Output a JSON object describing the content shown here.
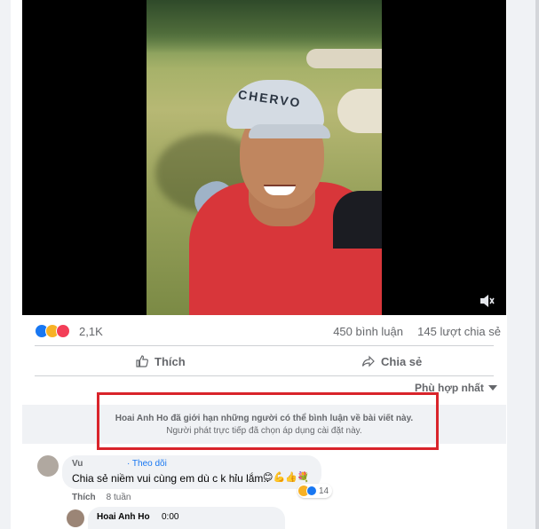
{
  "video": {
    "cap_brand": "CHERVO",
    "mute_icon": "speaker-muted-icon"
  },
  "stats": {
    "reaction_count": "2,1K",
    "comment_count": "450 bình luận",
    "share_count": "145 lượt chia sẻ",
    "reaction_icons": [
      "like",
      "haha",
      "love"
    ]
  },
  "actions": {
    "like_label": "Thích",
    "share_label": "Chia sẻ"
  },
  "sort": {
    "label": "Phù hợp nhất"
  },
  "notice": {
    "title": "Hoai Anh Ho đã giới hạn những người có thể bình luận về bài viết này.",
    "subtitle": "Người phát trực tiếp đã chọn áp dụng cài đặt này."
  },
  "comment": {
    "author": "Vu",
    "follow": "· Theo dõi",
    "text": "Chia sẻ niềm vui cùng em dù c k hỉu lắm..",
    "emojis": "😊💪👍💐",
    "reaction_count": "14",
    "like_label": "Thích",
    "time": "8 tuần"
  },
  "reply": {
    "author": "Hoai Anh Ho",
    "timecode": "0:00"
  },
  "colors": {
    "accent": "#1877f2",
    "highlight": "#d9242b",
    "muted_text": "#65676b"
  }
}
